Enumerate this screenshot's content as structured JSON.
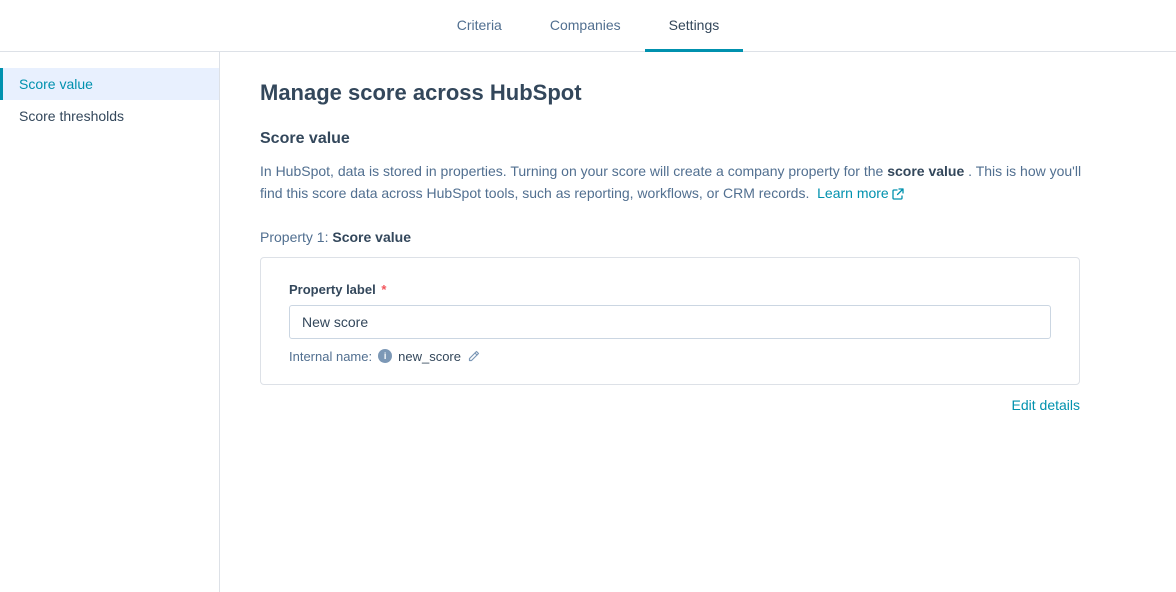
{
  "nav": {
    "tabs": [
      {
        "id": "criteria",
        "label": "Criteria",
        "active": false
      },
      {
        "id": "companies",
        "label": "Companies",
        "active": false
      },
      {
        "id": "settings",
        "label": "Settings",
        "active": true
      }
    ]
  },
  "sidebar": {
    "items": [
      {
        "id": "score-value",
        "label": "Score value",
        "active": true
      },
      {
        "id": "score-thresholds",
        "label": "Score thresholds",
        "active": false
      }
    ]
  },
  "content": {
    "page_title": "Manage score across HubSpot",
    "section_title": "Score value",
    "description_part1": "In HubSpot, data is stored in properties. Turning on your score will create a company property for the",
    "description_bold": "score value",
    "description_part2": ". This is how you'll find this score data across HubSpot tools, such as reporting, workflows, or CRM records.",
    "learn_more_label": "Learn more",
    "property_header_prefix": "Property 1:",
    "property_header_bold": "Score value",
    "field_label": "Property label",
    "field_required_symbol": "*",
    "field_value": "New score",
    "internal_name_label": "Internal name:",
    "internal_name_value": "new_score",
    "edit_details_label": "Edit details"
  },
  "icons": {
    "info": "i",
    "edit_pencil": "✎",
    "external_link": "↗"
  }
}
